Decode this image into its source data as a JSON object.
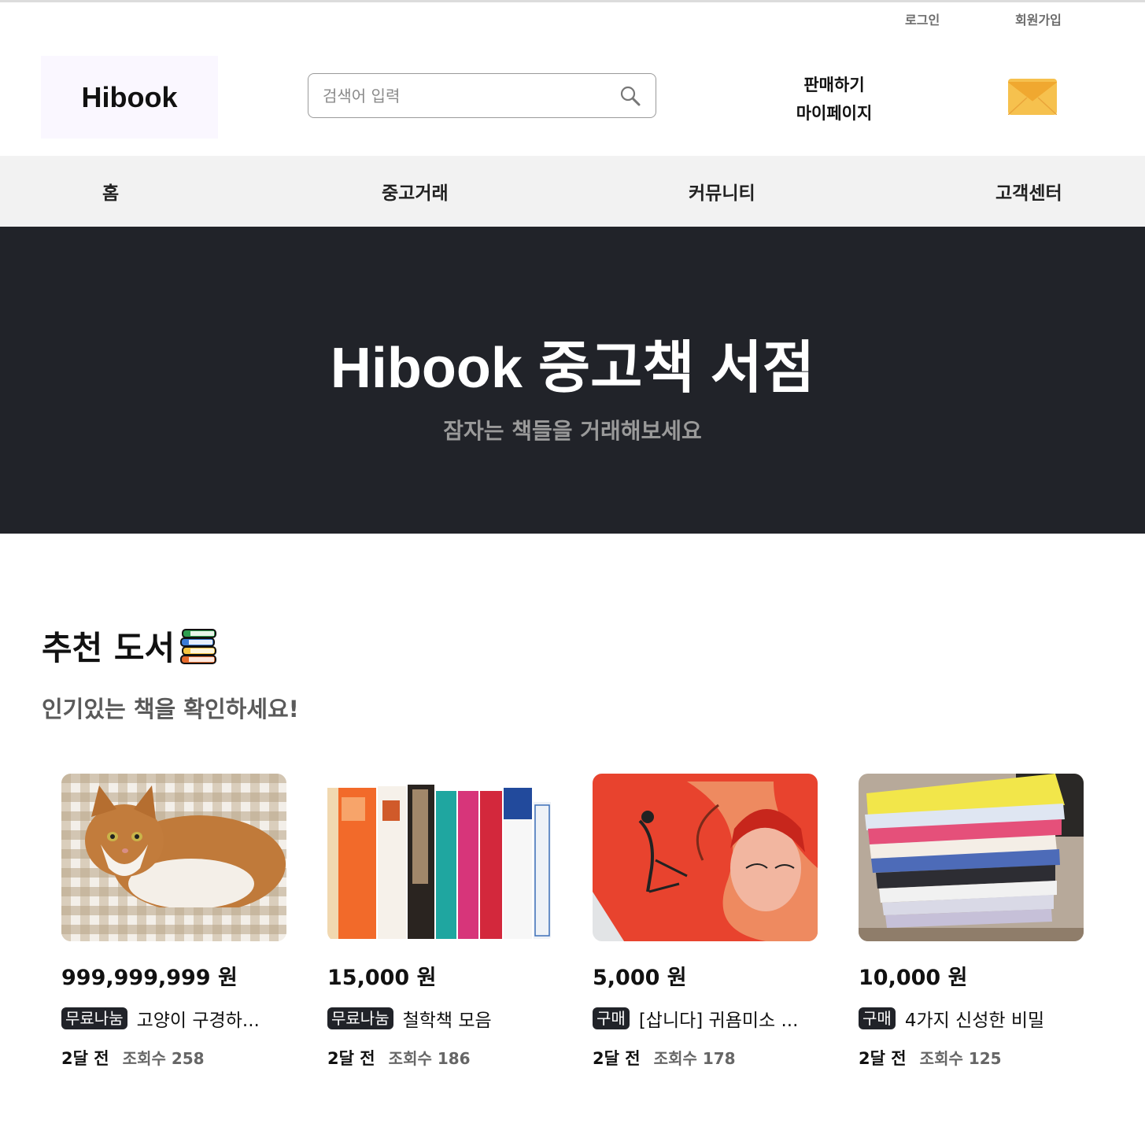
{
  "top_links": {
    "login": "로그인",
    "signup": "회원가입"
  },
  "header": {
    "logo": "Hibook",
    "search_placeholder": "검색어 입력",
    "sell": "판매하기",
    "mypage": "마이페이지"
  },
  "nav": {
    "items": [
      "홈",
      "중고거래",
      "커뮤니티",
      "고객센터"
    ]
  },
  "hero": {
    "title": "Hibook 중고책 서점",
    "subtitle": "잠자는 책들을 거래해보세요"
  },
  "section": {
    "title": "추천 도서",
    "subtitle": "인기있는 책을 확인하세요!"
  },
  "cards": [
    {
      "price": "999,999,999 원",
      "badge": "무료나눔",
      "title": "고양이 구경하...",
      "ago": "2달 전",
      "views": "조회수 258",
      "image": "cat photo"
    },
    {
      "price": "15,000 원",
      "badge": "무료나눔",
      "title": "철학책 모음",
      "ago": "2달 전",
      "views": "조회수 186",
      "image": "book spines"
    },
    {
      "price": "5,000 원",
      "badge": "구매",
      "title": "[삽니다] 귀욤미소 ...",
      "ago": "2달 전",
      "views": "조회수 178",
      "image": "red book cover"
    },
    {
      "price": "10,000 원",
      "badge": "구매",
      "title": "4가지 신성한 비밀",
      "ago": "2달 전",
      "views": "조회수 125",
      "image": "stacked books"
    }
  ],
  "colors": {
    "hero_bg": "#212329",
    "nav_bg": "#f2f2f2",
    "logo_bg": "#faf7ff",
    "badge_bg": "#212329",
    "mail_icon": "#f5b942"
  }
}
